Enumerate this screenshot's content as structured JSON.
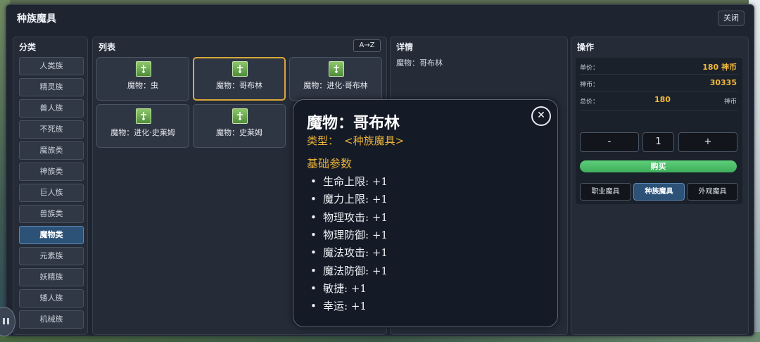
{
  "window": {
    "title": "种族魔具",
    "close_label": "关闭"
  },
  "category_panel": {
    "title": "分类",
    "items": [
      {
        "label": "人类族",
        "active": false
      },
      {
        "label": "精灵族",
        "active": false
      },
      {
        "label": "兽人族",
        "active": false
      },
      {
        "label": "不死族",
        "active": false
      },
      {
        "label": "魔族类",
        "active": false
      },
      {
        "label": "神族类",
        "active": false
      },
      {
        "label": "巨人族",
        "active": false
      },
      {
        "label": "兽族类",
        "active": false
      },
      {
        "label": "魔物类",
        "active": true
      },
      {
        "label": "元素族",
        "active": false
      },
      {
        "label": "妖精族",
        "active": false
      },
      {
        "label": "矮人族",
        "active": false
      },
      {
        "label": "机械族",
        "active": false
      }
    ]
  },
  "list_panel": {
    "title": "列表",
    "sort_label": "A→Z",
    "items": [
      {
        "label": "魔物：虫",
        "icon": "sword-cross-icon",
        "selected": false
      },
      {
        "label": "魔物：哥布林",
        "icon": "sword-cross-icon",
        "selected": true
      },
      {
        "label": "魔物：进化·哥布林",
        "icon": "sword-cross-icon",
        "selected": false
      },
      {
        "label": "魔物：进化·史莱姆",
        "icon": "sword-cross-icon",
        "selected": false
      },
      {
        "label": "魔物：史莱姆",
        "icon": "sword-cross-icon",
        "selected": false
      }
    ]
  },
  "detail_panel": {
    "title": "详情",
    "text": "魔物：哥布林"
  },
  "ops_panel": {
    "title": "操作",
    "unit_price_label": "单价：",
    "unit_price_value": "180 神币",
    "balance_label": "神币：",
    "balance_value": "30335",
    "total_label": "总价：",
    "total_value": "180",
    "total_currency": "神币",
    "minus_label": "-",
    "quantity": "1",
    "plus_label": "+",
    "buy_label": "购买",
    "tabs": [
      {
        "label": "职业魔具",
        "active": false
      },
      {
        "label": "种族魔具",
        "active": true
      },
      {
        "label": "外观魔具",
        "active": false
      }
    ]
  },
  "tooltip": {
    "title": "魔物：哥布林",
    "close_glyph": "✕",
    "type_label": "类型：",
    "type_value": "<种族魔具>",
    "section_title": "基础参数",
    "bullet": "•",
    "stats": [
      "生命上限: +1",
      "魔力上限: +1",
      "物理攻击: +1",
      "物理防御: +1",
      "魔法攻击: +1",
      "魔法防御: +1",
      "敏捷: +1",
      "幸运: +1"
    ]
  },
  "colors": {
    "accent_gold": "#e9b23a",
    "active_blue": "#2c5278",
    "buy_green": "#4fbf6b",
    "panel": "#252c38"
  }
}
